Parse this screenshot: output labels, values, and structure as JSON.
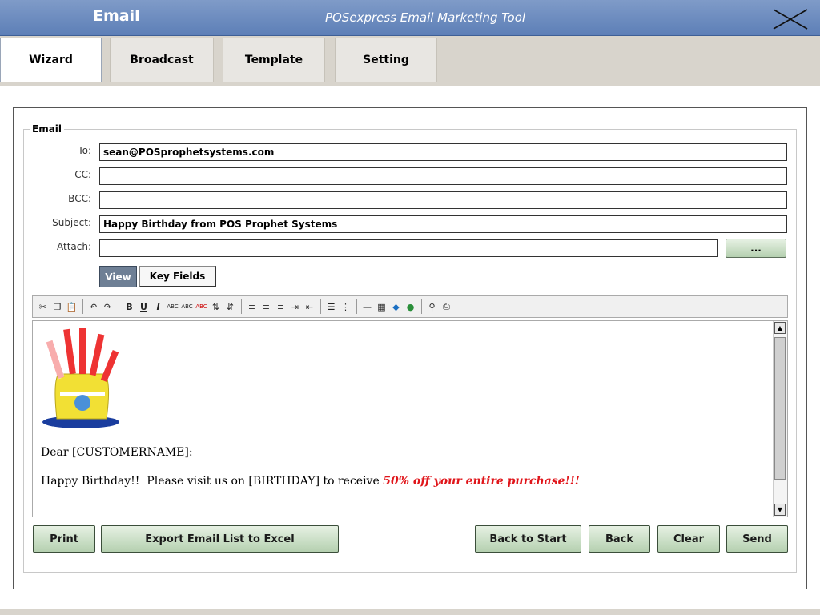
{
  "window": {
    "app_name": "Email",
    "subtitle": "POSexpress Email Marketing Tool",
    "close_icon": "close-x-icon"
  },
  "tabs": [
    {
      "label": "Wizard",
      "active": true
    },
    {
      "label": "Broadcast",
      "active": false
    },
    {
      "label": "Template",
      "active": false
    },
    {
      "label": "Setting",
      "active": false
    }
  ],
  "email": {
    "group_title": "Email",
    "to_label": "To:",
    "to_value": "sean@POSprophetsystems.com",
    "cc_label": "CC:",
    "cc_value": "",
    "bcc_label": "BCC:",
    "bcc_value": "",
    "subject_label": "Subject:",
    "subject_value": "Happy Birthday from POS Prophet Systems",
    "attach_label": "Attach:",
    "attach_value": "",
    "browse_label": "..."
  },
  "editor_toggles": {
    "view_label": "View",
    "key_fields_label": "Key Fields"
  },
  "toolbar_icons": [
    "cut-icon",
    "copy-icon",
    "paste-icon",
    "undo-icon",
    "redo-icon",
    "bold-icon",
    "underline-icon",
    "italic-icon",
    "small-caps-icon",
    "strikethrough-icon",
    "text-color-icon",
    "sort-ascending-icon",
    "sort-descending-icon",
    "align-left-icon",
    "align-center-icon",
    "align-right-icon",
    "indent-icon",
    "outdent-icon",
    "bulleted-list-icon",
    "numbered-list-icon",
    "horizontal-rule-icon",
    "table-icon",
    "image-icon",
    "link-icon",
    "find-icon",
    "print-icon"
  ],
  "message": {
    "image": "birthday-cake-hat-icon",
    "greeting": "Dear [CUSTOMERNAME]:",
    "body_prefix": "Happy Birthday!!  Please visit us on [BIRTHDAY] to receive ",
    "body_highlight": "50% off your entire purchase!!!",
    "highlight_color": "#e0161b"
  },
  "actions": {
    "print_label": "Print",
    "export_label": "Export Email List to Excel",
    "back_to_start_label": "Back to Start",
    "back_label": "Back",
    "clear_label": "Clear",
    "send_label": "Send"
  },
  "colors": {
    "titlebar": "#6f8ec2",
    "button_green": "#b5d0b0",
    "view_active": "#6e7f95"
  }
}
